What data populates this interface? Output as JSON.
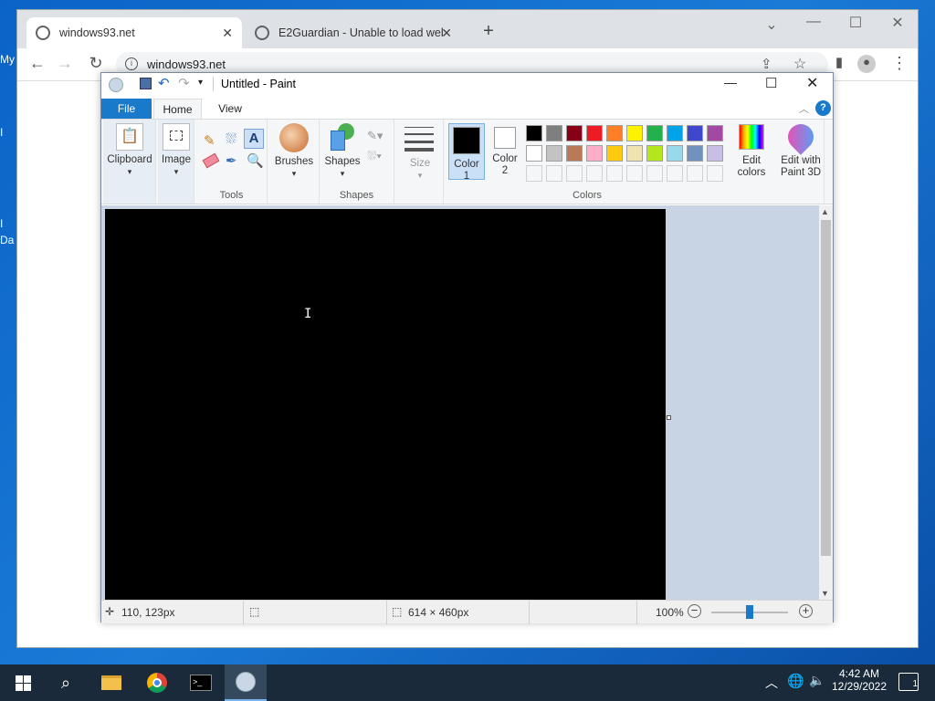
{
  "desktop": {
    "icon1_label": "My",
    "icon2_label": "I",
    "icon3_label": "I",
    "icon4_label": "Da"
  },
  "browser": {
    "tabs": [
      {
        "label": "windows93.net"
      },
      {
        "label": "E2Guardian - Unable to load web"
      }
    ],
    "address": "windows93.net"
  },
  "paint": {
    "title": "Untitled - Paint",
    "ribbon_tabs": [
      "File",
      "Home",
      "View"
    ],
    "groups": {
      "clipboard": "Clipboard",
      "image": "Image",
      "tools": "Tools",
      "brushes": "Brushes",
      "shapes_btn": "Shapes",
      "shapes": "Shapes",
      "size": "Size",
      "color1": "Color\n1",
      "color2": "Color\n2",
      "colors": "Colors",
      "edit_colors": "Edit\ncolors",
      "paint3d": "Edit with\nPaint 3D"
    },
    "palette_row1": [
      "#000000",
      "#7f7f7f",
      "#880015",
      "#ed1c24",
      "#ff7f27",
      "#fff200",
      "#22b14c",
      "#00a2e8",
      "#3f48cc",
      "#a349a4"
    ],
    "palette_row2": [
      "#ffffff",
      "#c3c3c3",
      "#b97a57",
      "#ffaec9",
      "#ffc90e",
      "#efe4b0",
      "#b5e61d",
      "#99d9ea",
      "#7092be",
      "#c8bfe7"
    ],
    "color1": "#000000",
    "color2": "#ffffff",
    "status": {
      "cursor": "110, 123px",
      "size": "614 × 460px",
      "zoom": "100%"
    }
  },
  "taskbar": {
    "time": "4:42 AM",
    "date": "12/29/2022",
    "notif_count": "1"
  }
}
